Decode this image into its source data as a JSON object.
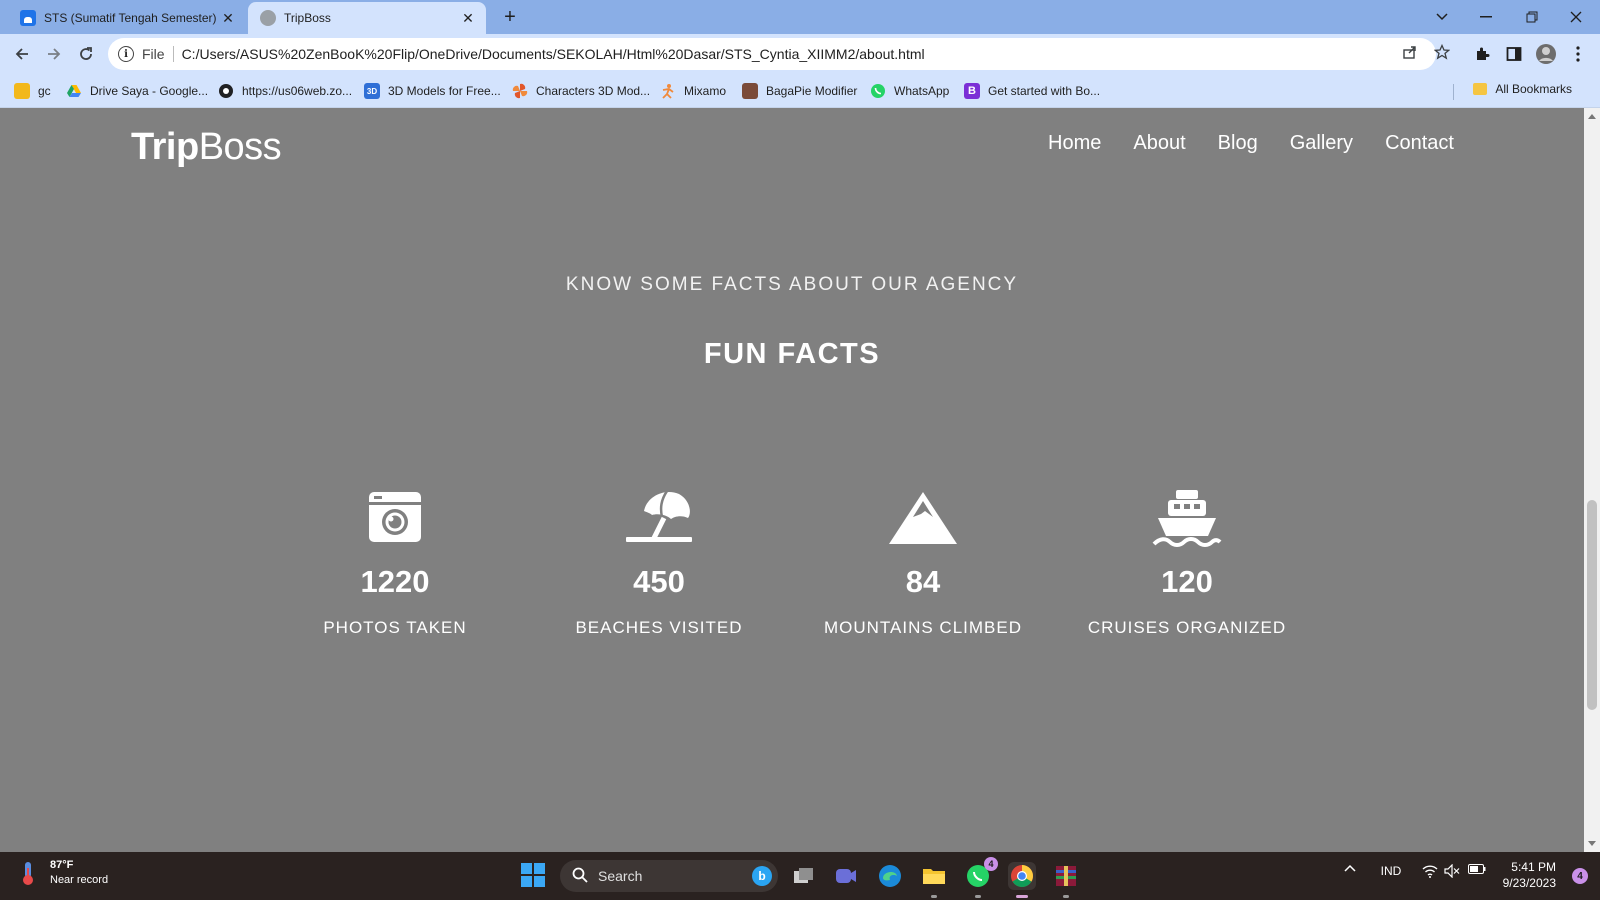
{
  "browser": {
    "tabs": [
      {
        "title": "STS (Sumatif Tengah Semester) C",
        "favicon": "classroom-icon",
        "active": false
      },
      {
        "title": "TripBoss",
        "favicon": "globe-icon",
        "active": true
      }
    ],
    "new_tab_label": "+",
    "address": {
      "scheme": "File",
      "url": "C:/Users/ASUS%20ZenBooK%20Flip/OneDrive/Documents/SEKOLAH/Html%20Dasar/STS_Cyntia_XIIMM2/about.html"
    },
    "bookmarks": [
      {
        "label": "gc",
        "icon": "contacts-icon",
        "color": "#f2b81c"
      },
      {
        "label": "Drive Saya - Google...",
        "icon": "drive-icon",
        "color": "#1fa463"
      },
      {
        "label": "https://us06web.zo...",
        "icon": "link-icon",
        "color": "#202124"
      },
      {
        "label": "3D Models for Free...",
        "icon": "3d-icon",
        "color": "#2f6fd6"
      },
      {
        "label": "Characters 3D Mod...",
        "icon": "pinwheel-icon",
        "color": "#e2572b"
      },
      {
        "label": "Mixamo",
        "icon": "mixamo-icon",
        "color": "#f08a3c"
      },
      {
        "label": "BagaPie Modifier",
        "icon": "bagapie-icon",
        "color": "#7b4b3a"
      },
      {
        "label": "WhatsApp",
        "icon": "whatsapp-icon",
        "color": "#25d366"
      },
      {
        "label": "Get started with Bo...",
        "icon": "bootstrap-icon",
        "color": "#7b2fd6"
      }
    ],
    "all_bookmarks_label": "All Bookmarks"
  },
  "site": {
    "logo_bold": "Trip",
    "logo_light": "Boss",
    "nav": [
      "Home",
      "About",
      "Blog",
      "Gallery",
      "Contact"
    ],
    "eyebrow": "KNOW SOME FACTS ABOUT OUR AGENCY",
    "section_title": "FUN FACTS",
    "facts": [
      {
        "icon": "camera-icon",
        "number": "1220",
        "label": "PHOTOS TAKEN"
      },
      {
        "icon": "beach-umbrella-icon",
        "number": "450",
        "label": "BEACHES VISITED"
      },
      {
        "icon": "mountain-icon",
        "number": "84",
        "label": "MOUNTAINS CLIMBED"
      },
      {
        "icon": "ship-icon",
        "number": "120",
        "label": "CRUISES ORGANIZED"
      }
    ],
    "colors": {
      "background": "#808080",
      "accent": "#16c5c0",
      "text": "#ffffff"
    }
  },
  "taskbar": {
    "weather_temp": "87°F",
    "weather_desc": "Near record",
    "search_placeholder": "Search",
    "whatsapp_badge": "4",
    "language": "IND",
    "time": "5:41 PM",
    "date": "9/23/2023",
    "notification_count": "4"
  }
}
